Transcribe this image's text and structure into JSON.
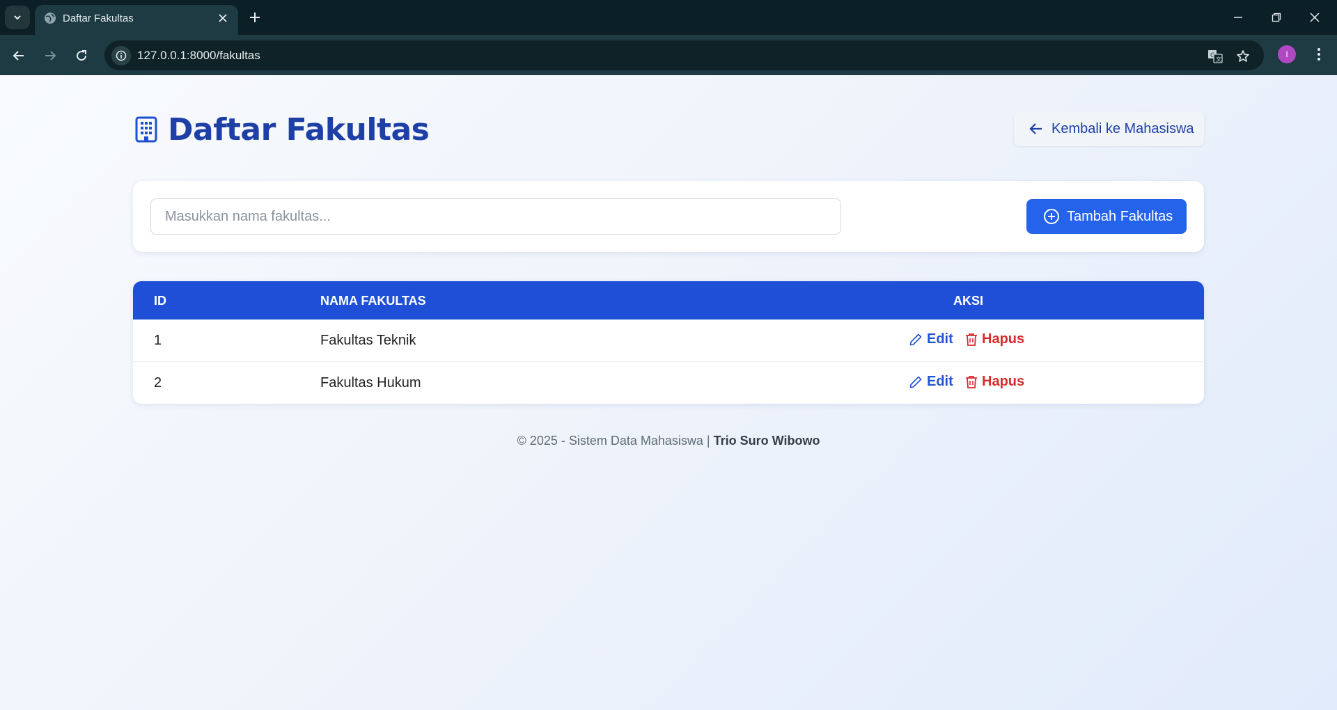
{
  "browser": {
    "tab_title": "Daftar Fakultas",
    "url": "127.0.0.1:8000/fakultas",
    "profile_initial": "I"
  },
  "header": {
    "title": "Daftar Fakultas",
    "title_icon": "building-icon",
    "back_label": "Kembali ke Mahasiswa"
  },
  "search": {
    "placeholder": "Masukkan nama fakultas...",
    "value": "",
    "add_label": "Tambah Fakultas"
  },
  "table": {
    "columns": [
      "ID",
      "NAMA FAKULTAS",
      "AKSI"
    ],
    "rows": [
      {
        "id": "1",
        "name": "Fakultas Teknik",
        "edit": "Edit",
        "delete": "Hapus"
      },
      {
        "id": "2",
        "name": "Fakultas Hukum",
        "edit": "Edit",
        "delete": "Hapus"
      }
    ]
  },
  "footer": {
    "text": "© 2025 - Sistem Data Mahasiswa | ",
    "author": "Trio Suro Wibowo"
  },
  "colors": {
    "primary": "#2563eb",
    "header_blue": "#1f4fd6",
    "title_blue": "#1e3fa5",
    "danger": "#d62b2b"
  }
}
